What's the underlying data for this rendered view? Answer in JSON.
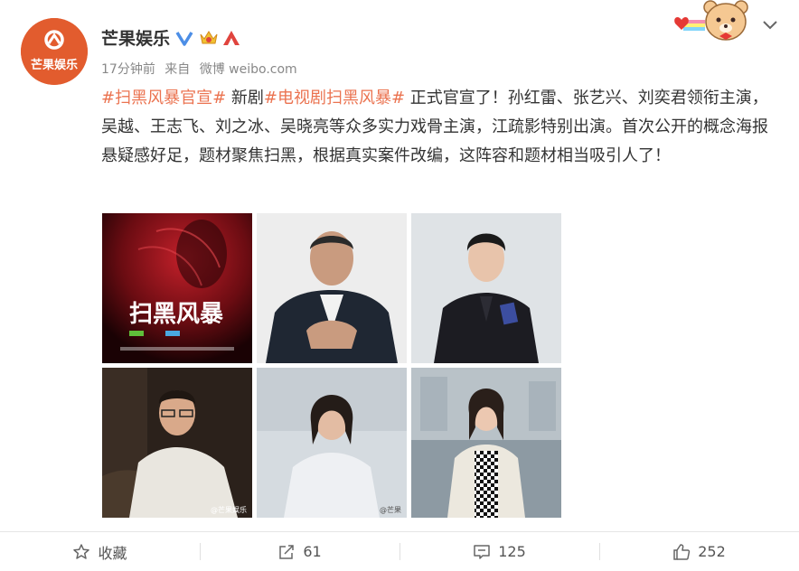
{
  "post": {
    "author": "芒果娱乐",
    "avatar_text": "芒果娱乐",
    "time": "17分钟前",
    "source_prefix": "来自",
    "source": "微博 weibo.com",
    "text_parts": [
      {
        "type": "tag",
        "text": "#扫黑风暴官宣#"
      },
      {
        "type": "text",
        "text": " 新剧"
      },
      {
        "type": "tag",
        "text": "#电视剧扫黑风暴#"
      },
      {
        "type": "text",
        "text": " 正式官宣了！孙红雷、张艺兴、刘奕君领衔主演，吴越、王志飞、刘之冰、吴晓亮等众多实力戏骨主演，江疏影特别出演。首次公开的概念海报悬疑感好足，题材聚焦扫黑，根据真实案件改编，这阵容和题材相当吸引人了！"
      }
    ],
    "images": [
      {
        "name": "poster-image",
        "caption": "扫黑风暴"
      },
      {
        "name": "actor-photo-1",
        "caption": ""
      },
      {
        "name": "actor-photo-2",
        "caption": ""
      },
      {
        "name": "actor-photo-3",
        "caption": "@芒果娱乐"
      },
      {
        "name": "actor-photo-4",
        "caption": "@芒果"
      },
      {
        "name": "actor-photo-5",
        "caption": ""
      }
    ]
  },
  "footer": {
    "favorite_label": "收藏",
    "repost_count": "61",
    "comment_count": "125",
    "like_count": "252"
  },
  "colors": {
    "tag": "#eb7350",
    "avatar_bg": "#e25c2e",
    "verified": "#4c8ee6"
  },
  "icons": [
    "verified-icon",
    "crown-icon",
    "vip-icon",
    "bear-sticker-icon",
    "chevron-down-icon",
    "star-icon",
    "repost-icon",
    "comment-icon",
    "like-icon"
  ]
}
